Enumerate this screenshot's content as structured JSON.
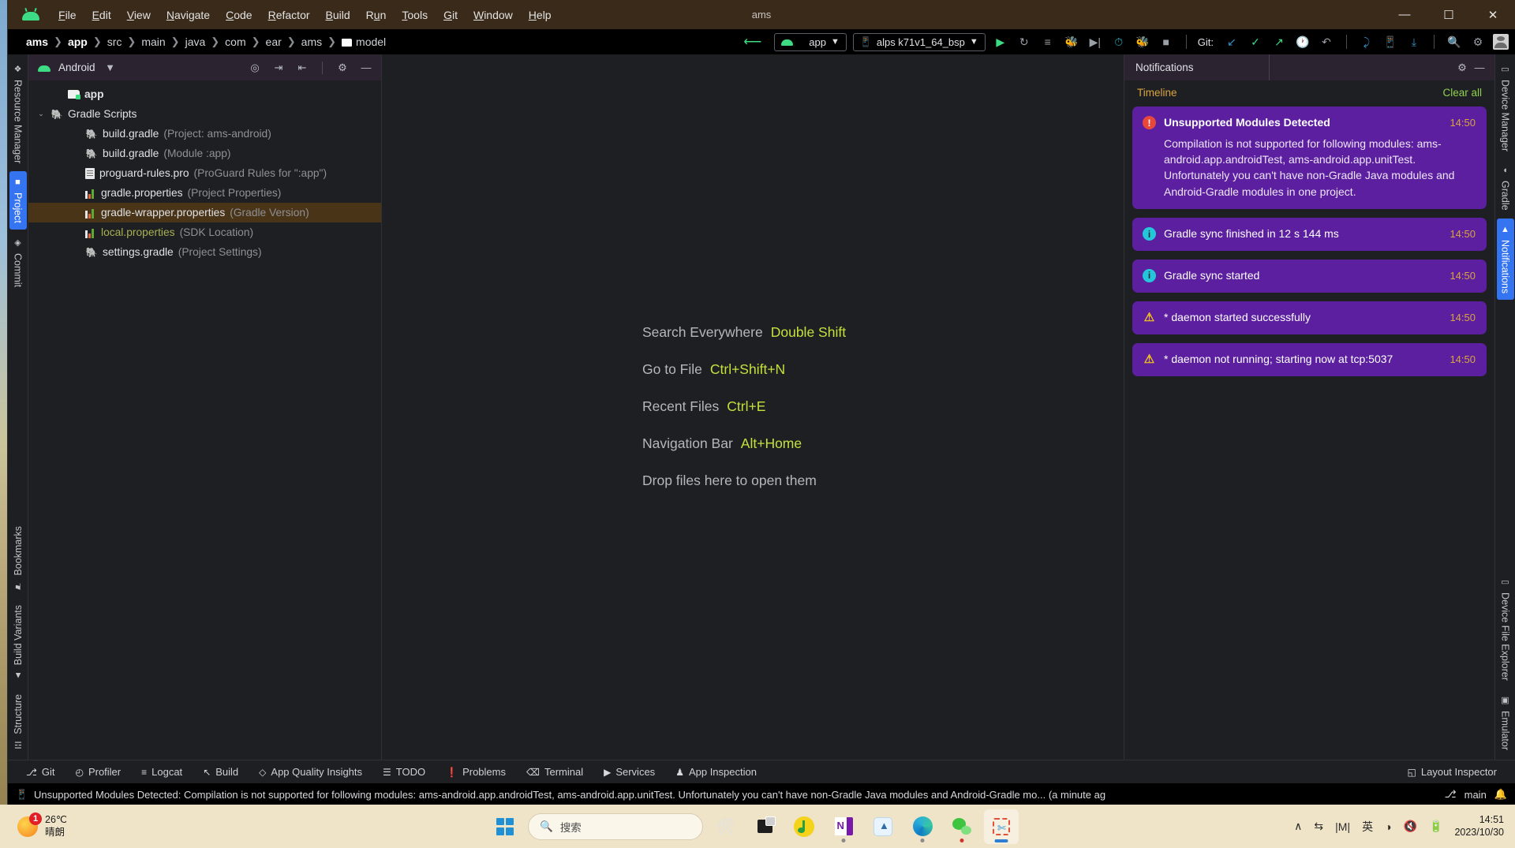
{
  "window": {
    "title": "ams",
    "minimize": "—",
    "maximize": "☐",
    "close": "✕"
  },
  "menubar": {
    "logo": "android-logo-icon",
    "items": [
      "File",
      "Edit",
      "View",
      "Navigate",
      "Code",
      "Refactor",
      "Build",
      "Run",
      "Tools",
      "Git",
      "Window",
      "Help"
    ]
  },
  "navbar": {
    "breadcrumbs": [
      "ams",
      "app",
      "src",
      "main",
      "java",
      "com",
      "ear",
      "ams",
      "model"
    ],
    "separator": "❯",
    "run_config": "app",
    "device": "alps k71v1_64_bsp",
    "git_label": "Git:"
  },
  "left_rail": {
    "top": [
      {
        "label": "Resource Manager",
        "icon": "resource-manager-icon",
        "active": false
      },
      {
        "label": "Project",
        "icon": "folder-icon",
        "active": true
      },
      {
        "label": "Commit",
        "icon": "commit-icon",
        "active": false
      }
    ],
    "bottom": [
      {
        "label": "Bookmarks",
        "icon": "bookmark-icon"
      },
      {
        "label": "Build Variants",
        "icon": "android-icon"
      },
      {
        "label": "Structure",
        "icon": "structure-icon"
      }
    ]
  },
  "right_rail": {
    "top": [
      {
        "label": "Device Manager",
        "icon": "device-manager-icon",
        "active": false
      },
      {
        "label": "Gradle",
        "icon": "gradle-elephant-icon",
        "active": false
      },
      {
        "label": "Notifications",
        "icon": "bell-icon",
        "active": true
      }
    ],
    "bottom": [
      {
        "label": "Device File Explorer",
        "icon": "device-file-explorer-icon"
      },
      {
        "label": "Emulator",
        "icon": "emulator-icon"
      }
    ]
  },
  "project_panel": {
    "title": "Android",
    "dropdown": "▼",
    "actions": [
      "select-opened-file-icon",
      "expand-all-icon",
      "collapse-all-icon",
      "gear-icon",
      "minimize-icon"
    ],
    "tree": [
      {
        "name": "app",
        "sub": "",
        "indent": 1,
        "icon": "module-folder-icon",
        "bold": true,
        "arrow": "",
        "selected": false,
        "color": "normal"
      },
      {
        "name": "Gradle Scripts",
        "sub": "",
        "indent": 0,
        "icon": "gradle-elephant-icon",
        "bold": false,
        "arrow": "⌄",
        "selected": false,
        "color": "normal"
      },
      {
        "name": "build.gradle",
        "sub": "(Project: ams-android)",
        "indent": 2,
        "icon": "gradle-elephant-icon",
        "bold": false,
        "arrow": "",
        "selected": false,
        "color": "normal"
      },
      {
        "name": "build.gradle",
        "sub": "(Module :app)",
        "indent": 2,
        "icon": "gradle-elephant-icon",
        "bold": false,
        "arrow": "",
        "selected": false,
        "color": "normal"
      },
      {
        "name": "proguard-rules.pro",
        "sub": "(ProGuard Rules for \":app\")",
        "indent": 2,
        "icon": "text-file-icon",
        "bold": false,
        "arrow": "",
        "selected": false,
        "color": "normal"
      },
      {
        "name": "gradle.properties",
        "sub": "(Project Properties)",
        "indent": 2,
        "icon": "properties-file-icon",
        "bold": false,
        "arrow": "",
        "selected": false,
        "color": "normal"
      },
      {
        "name": "gradle-wrapper.properties",
        "sub": "(Gradle Version)",
        "indent": 2,
        "icon": "properties-file-icon",
        "bold": false,
        "arrow": "",
        "selected": true,
        "color": "normal"
      },
      {
        "name": "local.properties",
        "sub": "(SDK Location)",
        "indent": 2,
        "icon": "properties-file-icon",
        "bold": false,
        "arrow": "",
        "selected": false,
        "color": "olive"
      },
      {
        "name": "settings.gradle",
        "sub": "(Project Settings)",
        "indent": 2,
        "icon": "gradle-elephant-icon",
        "bold": false,
        "arrow": "",
        "selected": false,
        "color": "normal"
      }
    ]
  },
  "editor": {
    "tips": [
      {
        "label": "Search Everywhere",
        "key": "Double Shift"
      },
      {
        "label": "Go to File",
        "key": "Ctrl+Shift+N"
      },
      {
        "label": "Recent Files",
        "key": "Ctrl+E"
      },
      {
        "label": "Navigation Bar",
        "key": "Alt+Home"
      },
      {
        "label": "Drop files here to open them",
        "key": ""
      }
    ]
  },
  "notifications": {
    "tab_title": "Notifications",
    "timeline_label": "Timeline",
    "clear_all_label": "Clear all",
    "items": [
      {
        "severity": "error",
        "icon": "error-icon",
        "title": "Unsupported Modules Detected",
        "time": "14:50",
        "body": "Compilation is not supported for following modules: ams-android.app.androidTest, ams-android.app.unitTest. Unfortunately you can't have non-Gradle Java modules and Android-Gradle modules in one project."
      },
      {
        "severity": "info",
        "icon": "info-icon",
        "title": "Gradle sync finished in 12 s 144 ms",
        "time": "14:50",
        "body": ""
      },
      {
        "severity": "info",
        "icon": "info-icon",
        "title": "Gradle sync started",
        "time": "14:50",
        "body": ""
      },
      {
        "severity": "warning",
        "icon": "warning-icon",
        "title": "* daemon started successfully",
        "time": "14:50",
        "body": ""
      },
      {
        "severity": "warning",
        "icon": "warning-icon",
        "title": "* daemon not running; starting now at tcp:5037",
        "time": "14:50",
        "body": ""
      }
    ]
  },
  "bottom_tools": {
    "left": [
      {
        "label": "Git",
        "icon": "git-branch-icon"
      },
      {
        "label": "Profiler",
        "icon": "profiler-icon"
      },
      {
        "label": "Logcat",
        "icon": "logcat-icon"
      },
      {
        "label": "Build",
        "icon": "hammer-icon"
      },
      {
        "label": "App Quality Insights",
        "icon": "diamond-icon"
      },
      {
        "label": "TODO",
        "icon": "todo-list-icon"
      },
      {
        "label": "Problems",
        "icon": "problems-icon"
      },
      {
        "label": "Terminal",
        "icon": "terminal-icon"
      },
      {
        "label": "Services",
        "icon": "services-icon"
      },
      {
        "label": "App Inspection",
        "icon": "app-inspection-icon"
      }
    ],
    "right": [
      {
        "label": "Layout Inspector",
        "icon": "layout-inspector-icon"
      }
    ]
  },
  "statusbar": {
    "icon": "event-log-icon",
    "message": "Unsupported Modules Detected: Compilation is not supported for following modules: ams-android.app.androidTest, ams-android.app.unitTest. Unfortunately you can't have non-Gradle Java modules and Android-Gradle mo... (a minute ag",
    "branch": "main",
    "branch_icon": "git-branch-icon",
    "right_icon": "notification-icon"
  },
  "taskbar": {
    "weather": {
      "temp": "26℃",
      "condition": "晴朗",
      "badge": "1"
    },
    "search_placeholder": "搜索",
    "search_icon": "search-icon",
    "start_icon": "windows-start-icon",
    "apps": [
      {
        "name": "tools-image-thumbnail",
        "running": false
      },
      {
        "name": "task-view-icon",
        "running": false
      },
      {
        "name": "qq-music-icon",
        "running": false
      },
      {
        "name": "onenote-icon",
        "running": true
      },
      {
        "name": "android-studio-icon",
        "running": true
      },
      {
        "name": "microsoft-edge-icon",
        "running": true
      },
      {
        "name": "wechat-icon",
        "running": true
      },
      {
        "name": "snipping-tool-icon",
        "running": true
      }
    ],
    "tray": [
      {
        "name": "show-hidden-icons-icon",
        "glyph": "∧"
      },
      {
        "name": "network-transfer-icon",
        "glyph": "⇄"
      },
      {
        "name": "input-level-icon",
        "glyph": "|M|"
      },
      {
        "name": "ime-language-icon",
        "glyph": "英"
      },
      {
        "name": "wifi-icon",
        "glyph": "◑"
      },
      {
        "name": "volume-muted-icon",
        "glyph": "🔈"
      },
      {
        "name": "battery-icon",
        "glyph": "▭"
      }
    ],
    "clock": {
      "time": "14:51",
      "date": "2023/10/30"
    }
  },
  "colors": {
    "accent_blue": "#3574f0",
    "green": "#3ddc84",
    "notification_purple": "#5b1fa0",
    "panel_header": "#2b2330",
    "selection_brown": "#4a3418",
    "menubar_brown": "#3a2a19",
    "key_yellow": "#c5e03d",
    "taskbar_beige": "#efe3c8"
  }
}
